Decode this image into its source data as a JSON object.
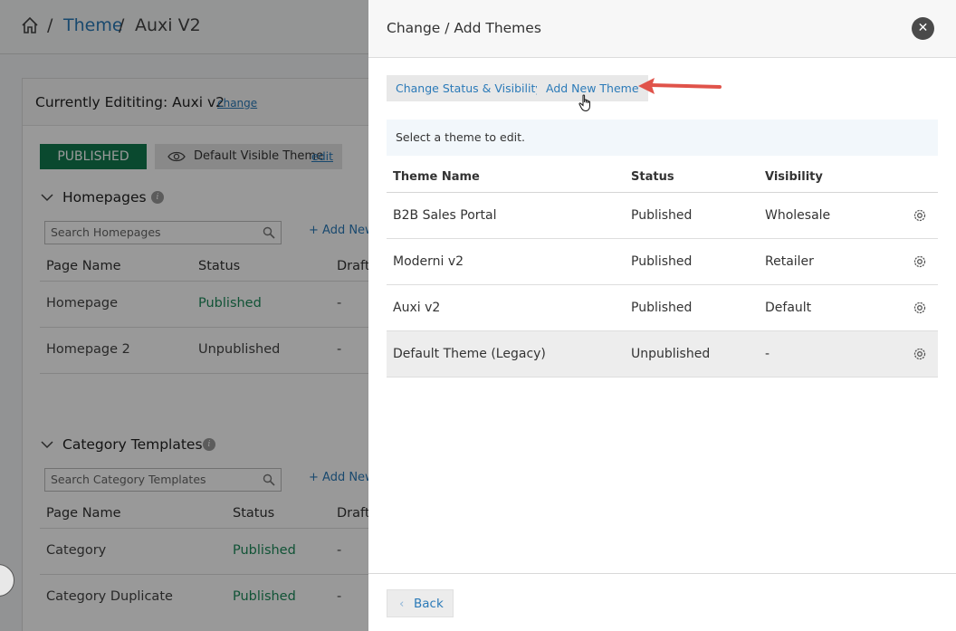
{
  "breadcrumb": {
    "separator": "/",
    "theme_link": "Theme",
    "current": "Auxi V2"
  },
  "editor": {
    "heading": "Currently Edititing: Auxi v2",
    "change_link": "change",
    "published_badge": "PUBLISHED",
    "visibility_label": "Default Visible Theme",
    "visibility_edit": "edit"
  },
  "homepages": {
    "title": "Homepages",
    "search_placeholder": "Search Homepages",
    "add_new": "+ Add New",
    "columns": [
      "Page Name",
      "Status",
      "Draft"
    ],
    "rows": [
      {
        "name": "Homepage",
        "status": "Published",
        "draft": "-"
      },
      {
        "name": "Homepage 2",
        "status": "Unpublished",
        "draft": "-"
      }
    ]
  },
  "category_templates": {
    "title": "Category Templates",
    "search_placeholder": "Search Category Templates",
    "add_new": "+ Add New",
    "columns": [
      "Page Name",
      "Status",
      "Draft"
    ],
    "rows": [
      {
        "name": "Category",
        "status": "Published",
        "draft": "-"
      },
      {
        "name": "Category Duplicate",
        "status": "Published",
        "draft": "-"
      }
    ]
  },
  "panel": {
    "title": "Change / Add Themes",
    "close_icon": "✕",
    "tabs": {
      "change_status": "Change Status & Visibility",
      "add_new_theme": "Add New Theme"
    },
    "notice": "Select a theme to edit.",
    "table": {
      "headers": {
        "name": "Theme Name",
        "status": "Status",
        "visibility": "Visibility"
      },
      "rows": [
        {
          "name": "B2B Sales Portal",
          "status": "Published",
          "visibility": "Wholesale"
        },
        {
          "name": "Moderni v2",
          "status": "Published",
          "visibility": "Retailer"
        },
        {
          "name": "Auxi v2",
          "status": "Published",
          "visibility": "Default"
        },
        {
          "name": "Default Theme (Legacy)",
          "status": "Unpublished",
          "visibility": "-"
        }
      ]
    },
    "back_chevron": "‹",
    "back_label": "Back"
  },
  "colors": {
    "accent_link": "#2b7ab8",
    "published_green": "#1d8a5a",
    "published_badge_bg": "#117a4f",
    "annotation_arrow": "#e0534a"
  }
}
